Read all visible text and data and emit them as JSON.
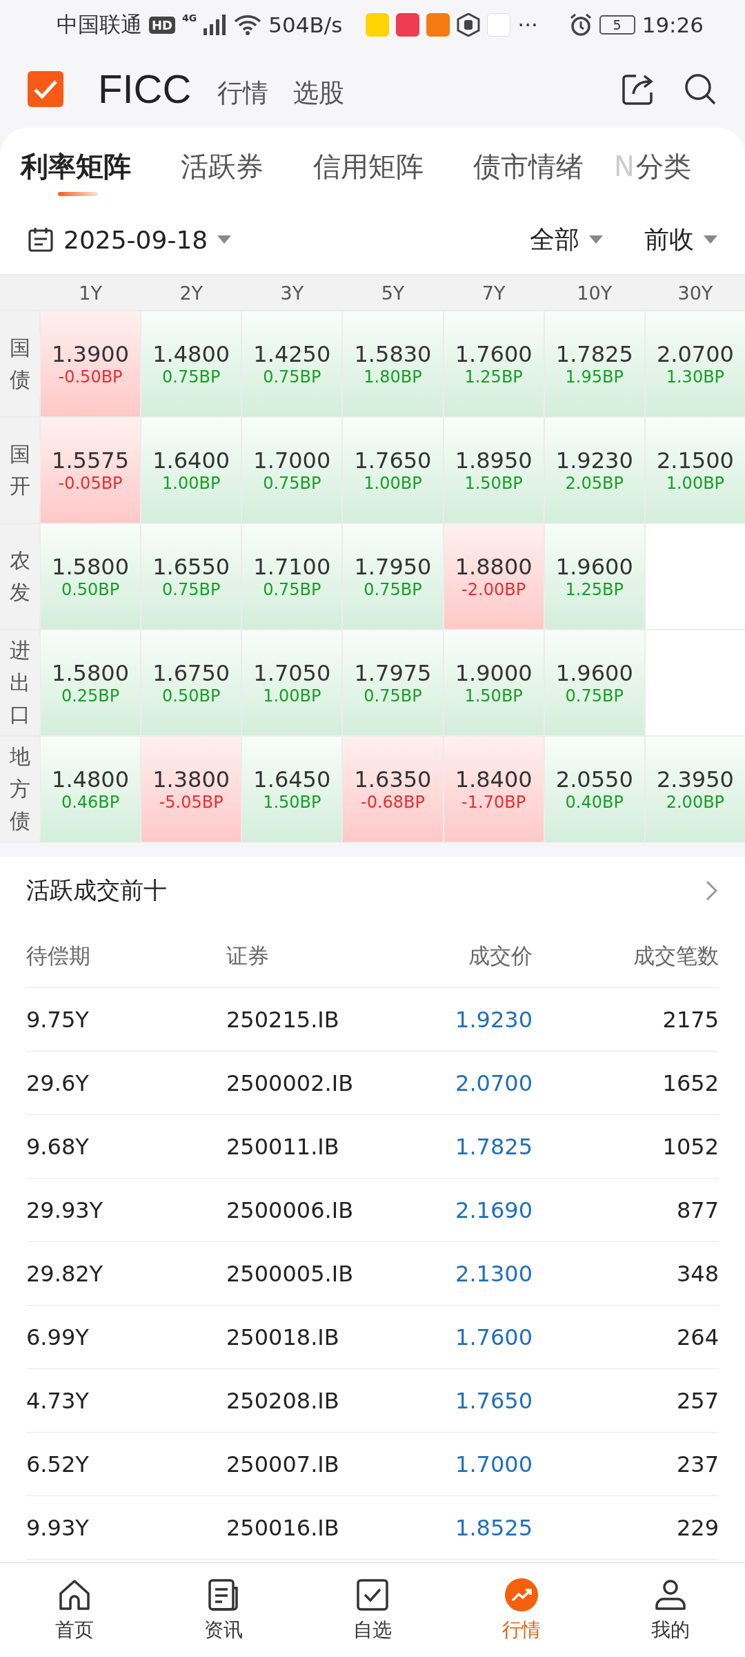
{
  "status_bar": {
    "carrier": "中国联通",
    "hd": "HD",
    "network": "4G",
    "speed": "504B/s",
    "more": "···",
    "battery": "5",
    "time": "19:26"
  },
  "header": {
    "title": "FICC",
    "nav": [
      {
        "label": "行情",
        "selected": false
      },
      {
        "label": "选股",
        "selected": false
      }
    ]
  },
  "tabs": [
    {
      "label": "利率矩阵",
      "selected": true
    },
    {
      "label": "活跃券",
      "selected": false
    },
    {
      "label": "信用矩阵",
      "selected": false
    },
    {
      "label": "债市情绪",
      "selected": false
    }
  ],
  "overflow_tab": "N",
  "category_button": "分类",
  "filters": {
    "date": "2025-09-18",
    "scope": "全部",
    "basis": "前收"
  },
  "matrix": {
    "columns": [
      "1Y",
      "2Y",
      "3Y",
      "5Y",
      "7Y",
      "10Y",
      "30Y"
    ],
    "rows": [
      {
        "label": "国债",
        "cells": [
          {
            "value": "1.3900",
            "change": "-0.50BP",
            "kind": "down"
          },
          {
            "value": "1.4800",
            "change": "0.75BP",
            "kind": "up"
          },
          {
            "value": "1.4250",
            "change": "0.75BP",
            "kind": "up"
          },
          {
            "value": "1.5830",
            "change": "1.80BP",
            "kind": "up"
          },
          {
            "value": "1.7600",
            "change": "1.25BP",
            "kind": "up"
          },
          {
            "value": "1.7825",
            "change": "1.95BP",
            "kind": "up"
          },
          {
            "value": "2.0700",
            "change": "1.30BP",
            "kind": "up"
          }
        ]
      },
      {
        "label": "国开",
        "cells": [
          {
            "value": "1.5575",
            "change": "-0.05BP",
            "kind": "down"
          },
          {
            "value": "1.6400",
            "change": "1.00BP",
            "kind": "up"
          },
          {
            "value": "1.7000",
            "change": "0.75BP",
            "kind": "up"
          },
          {
            "value": "1.7650",
            "change": "1.00BP",
            "kind": "up"
          },
          {
            "value": "1.8950",
            "change": "1.50BP",
            "kind": "up"
          },
          {
            "value": "1.9230",
            "change": "2.05BP",
            "kind": "up"
          },
          {
            "value": "2.1500",
            "change": "1.00BP",
            "kind": "up"
          }
        ]
      },
      {
        "label": "农发",
        "cells": [
          {
            "value": "1.5800",
            "change": "0.50BP",
            "kind": "up"
          },
          {
            "value": "1.6550",
            "change": "0.75BP",
            "kind": "up"
          },
          {
            "value": "1.7100",
            "change": "0.75BP",
            "kind": "up"
          },
          {
            "value": "1.7950",
            "change": "0.75BP",
            "kind": "up"
          },
          {
            "value": "1.8800",
            "change": "-2.00BP",
            "kind": "down"
          },
          {
            "value": "1.9600",
            "change": "1.25BP",
            "kind": "up"
          },
          {
            "kind": "empty"
          }
        ]
      },
      {
        "label": "进出口",
        "cells": [
          {
            "value": "1.5800",
            "change": "0.25BP",
            "kind": "up"
          },
          {
            "value": "1.6750",
            "change": "0.50BP",
            "kind": "up"
          },
          {
            "value": "1.7050",
            "change": "1.00BP",
            "kind": "up"
          },
          {
            "value": "1.7975",
            "change": "0.75BP",
            "kind": "up"
          },
          {
            "value": "1.9000",
            "change": "1.50BP",
            "kind": "up"
          },
          {
            "value": "1.9600",
            "change": "0.75BP",
            "kind": "up"
          },
          {
            "kind": "empty"
          }
        ]
      },
      {
        "label": "地方债",
        "cells": [
          {
            "value": "1.4800",
            "change": "0.46BP",
            "kind": "up"
          },
          {
            "value": "1.3800",
            "change": "-5.05BP",
            "kind": "down"
          },
          {
            "value": "1.6450",
            "change": "1.50BP",
            "kind": "up"
          },
          {
            "value": "1.6350",
            "change": "-0.68BP",
            "kind": "down"
          },
          {
            "value": "1.8400",
            "change": "-1.70BP",
            "kind": "down"
          },
          {
            "value": "2.0550",
            "change": "0.40BP",
            "kind": "up"
          },
          {
            "value": "2.3950",
            "change": "2.00BP",
            "kind": "up"
          }
        ]
      }
    ]
  },
  "active_trades": {
    "title": "活跃成交前十",
    "columns": [
      "待偿期",
      "证券",
      "成交价",
      "成交笔数"
    ],
    "rows": [
      [
        "9.75Y",
        "250215.IB",
        "1.9230",
        "2175"
      ],
      [
        "29.6Y",
        "2500002.IB",
        "2.0700",
        "1652"
      ],
      [
        "9.68Y",
        "250011.IB",
        "1.7825",
        "1052"
      ],
      [
        "29.93Y",
        "2500006.IB",
        "2.1690",
        "877"
      ],
      [
        "29.82Y",
        "2500005.IB",
        "2.1300",
        "348"
      ],
      [
        "6.99Y",
        "250018.IB",
        "1.7600",
        "264"
      ],
      [
        "4.73Y",
        "250208.IB",
        "1.7650",
        "257"
      ],
      [
        "6.52Y",
        "250007.IB",
        "1.7000",
        "237"
      ],
      [
        "9.93Y",
        "250016.IB",
        "1.8525",
        "229"
      ]
    ]
  },
  "bottom_nav": [
    {
      "label": "首页",
      "kind": "home",
      "selected": false
    },
    {
      "label": "资讯",
      "kind": "news",
      "selected": false
    },
    {
      "label": "自选",
      "kind": "check",
      "selected": false
    },
    {
      "label": "行情",
      "kind": "trend",
      "selected": true
    },
    {
      "label": "我的",
      "kind": "user",
      "selected": false
    }
  ]
}
